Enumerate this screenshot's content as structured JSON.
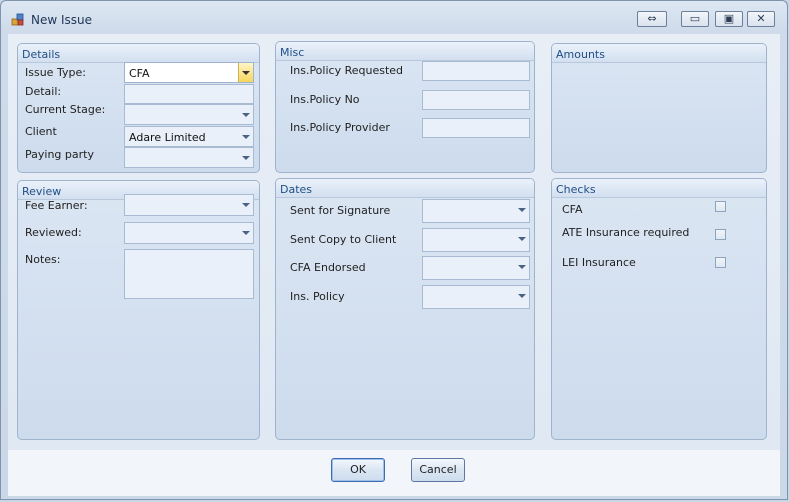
{
  "window": {
    "title": "New Issue",
    "controls": {
      "restore_glyph": "⇔",
      "minimize_glyph": "▭",
      "maximize_glyph": "▣",
      "close_glyph": "✕"
    }
  },
  "details": {
    "title": "Details",
    "issue_type_label": "Issue Type:",
    "issue_type_value": "CFA",
    "detail_label": "Detail:",
    "detail_value": "",
    "current_stage_label": "Current Stage:",
    "current_stage_value": "",
    "client_label": "Client",
    "client_value": "Adare Limited",
    "paying_party_label": "Paying party",
    "paying_party_value": ""
  },
  "misc": {
    "title": "Misc",
    "ins_policy_requested_label": "Ins.Policy Requested",
    "ins_policy_requested_value": "",
    "ins_policy_no_label": "Ins.Policy No",
    "ins_policy_no_value": "",
    "ins_policy_provider_label": "Ins.Policy Provider",
    "ins_policy_provider_value": ""
  },
  "amounts": {
    "title": "Amounts"
  },
  "review": {
    "title": "Review",
    "fee_earner_label": "Fee Earner:",
    "fee_earner_value": "",
    "reviewed_label": "Reviewed:",
    "reviewed_value": "",
    "notes_label": "Notes:",
    "notes_value": ""
  },
  "dates": {
    "title": "Dates",
    "sent_for_signature_label": "Sent for Signature",
    "sent_copy_to_client_label": "Sent Copy to Client",
    "cfa_endorsed_label": "CFA Endorsed",
    "ins_policy_label": "Ins. Policy"
  },
  "checks": {
    "title": "Checks",
    "cfa_label": "CFA",
    "ate_label": "ATE Insurance required",
    "lei_label": "LEI Insurance",
    "cfa_checked": false,
    "ate_checked": false,
    "lei_checked": false
  },
  "buttons": {
    "ok": "OK",
    "cancel": "Cancel"
  },
  "colors": {
    "panel_title": "#1f4e86",
    "active_dropdown": "#f7d65c"
  }
}
